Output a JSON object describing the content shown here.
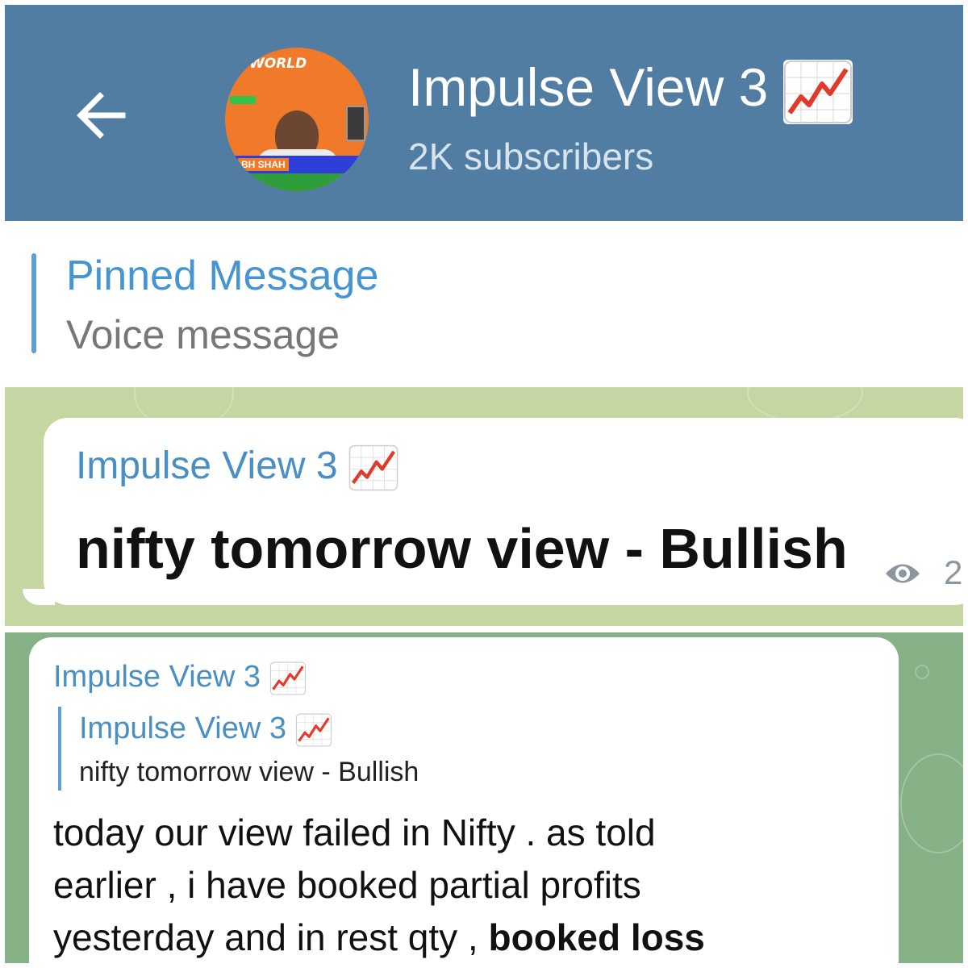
{
  "header": {
    "back_icon": "arrow-left-icon",
    "title": "Impulse View 3",
    "title_emoji": "chart-increasing-icon",
    "subtitle": "2K subscribers",
    "avatar": {
      "top_text": "WORLD",
      "band_text": "BH SHAH"
    },
    "bg_color": "#527da3"
  },
  "pinned": {
    "title": "Pinned Message",
    "preview": "Voice message",
    "accent_color": "#4694d0"
  },
  "message1": {
    "sender": "Impulse View 3",
    "text": "nifty tomorrow view - Bullish",
    "views": "2",
    "views_icon": "eye-icon"
  },
  "message2": {
    "sender": "Impulse View 3",
    "reply": {
      "sender": "Impulse View 3",
      "text": "nifty tomorrow view - Bullish"
    },
    "body_line1": "today our view failed in Nifty . as told",
    "body_line2": "earlier , i have booked partial profits",
    "body_line3_start": "yesterday and in rest qty , ",
    "body_line3_bold": "booked loss"
  },
  "colors": {
    "link_blue": "#4a8fc4",
    "chat_bg_top": "#c6d6a2",
    "chat_bg_bottom": "#86b086"
  }
}
